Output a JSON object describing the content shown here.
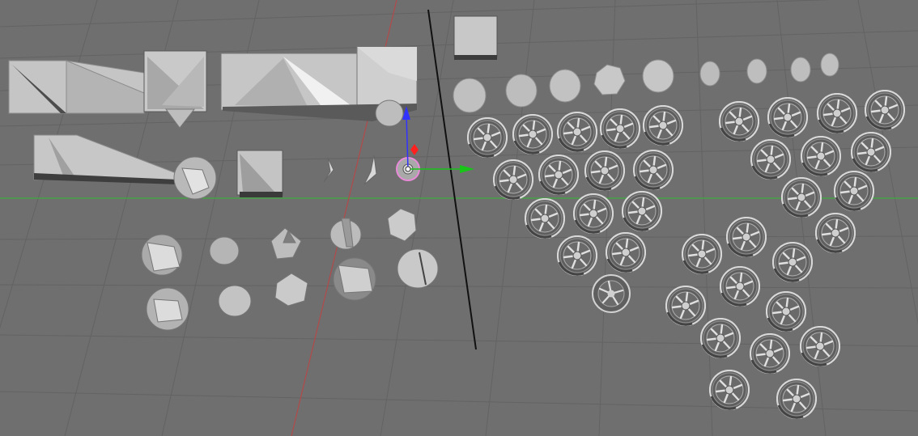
{
  "viewport": {
    "background": "#6f6f6f",
    "grid_color": "#626262",
    "x_axis_color": "#3fae3f",
    "y_axis_color": "#b24a4a",
    "mesh_color": "#c4c4c4",
    "mesh_highlight": "#e6e6e6",
    "mesh_shadow": "#555555",
    "selected_outline": "#e88ad8"
  },
  "gizmo": {
    "z_axis_color": "#3232ff",
    "x_axis_color": "#ff2020",
    "y_axis_color": "#18c418",
    "icons": [
      "move-gizmo-icon",
      "z-arrow-icon",
      "y-arrow-icon",
      "x-handle-icon"
    ]
  },
  "scene": {
    "object_groups": [
      "wedge-meshes",
      "rock-meshes",
      "stone-cylinders",
      "wheel-array-left",
      "wheel-array-right",
      "divider-line"
    ]
  }
}
